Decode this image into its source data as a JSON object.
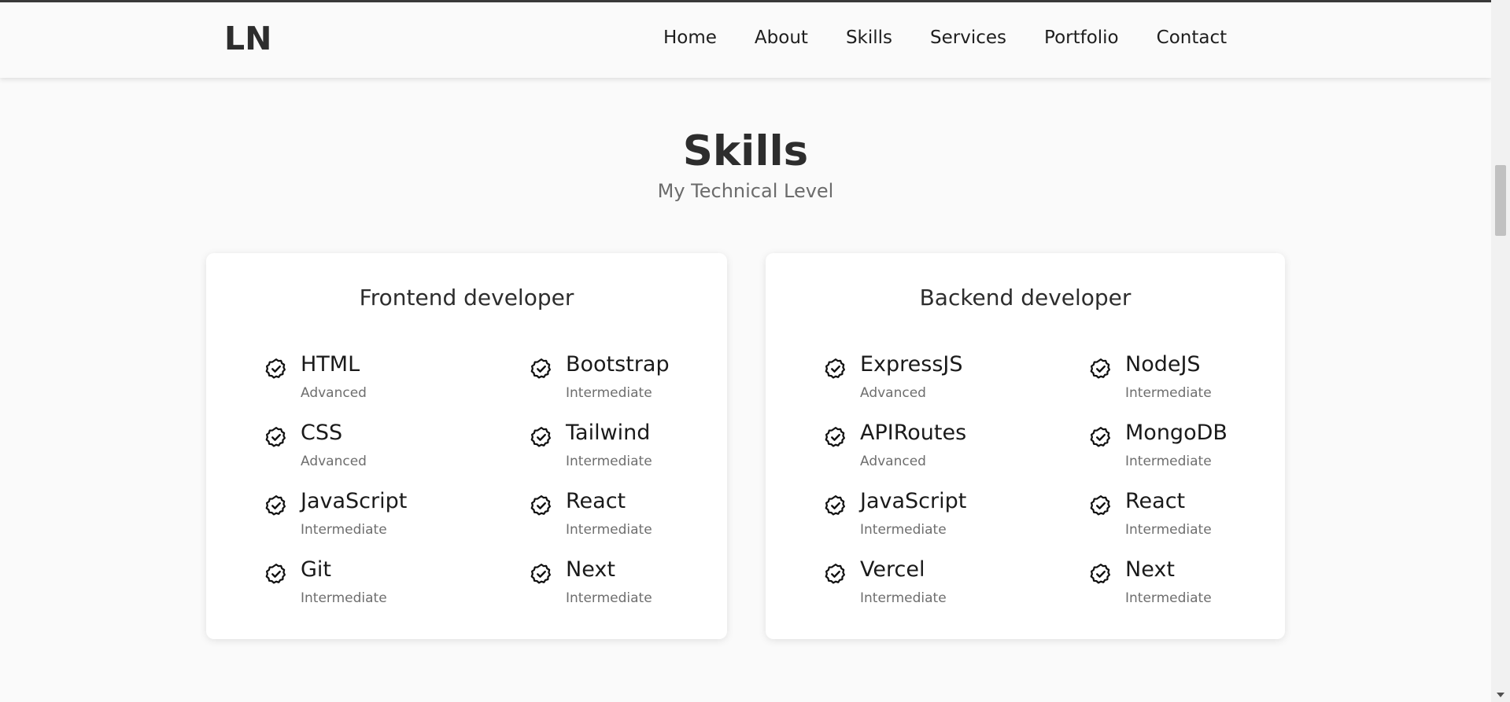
{
  "header": {
    "logo": "LN",
    "nav": [
      "Home",
      "About",
      "Skills",
      "Services",
      "Portfolio",
      "Contact"
    ]
  },
  "section": {
    "title": "Skills",
    "subtitle": "My Technical Level"
  },
  "cards": [
    {
      "title": "Frontend developer",
      "skills": [
        {
          "name": "HTML",
          "level": "Advanced"
        },
        {
          "name": "Bootstrap",
          "level": "Intermediate"
        },
        {
          "name": "CSS",
          "level": "Advanced"
        },
        {
          "name": "Tailwind",
          "level": "Intermediate"
        },
        {
          "name": "JavaScript",
          "level": "Intermediate"
        },
        {
          "name": "React",
          "level": "Intermediate"
        },
        {
          "name": "Git",
          "level": "Intermediate"
        },
        {
          "name": "Next",
          "level": "Intermediate"
        }
      ]
    },
    {
      "title": "Backend developer",
      "skills": [
        {
          "name": "ExpressJS",
          "level": "Advanced"
        },
        {
          "name": "NodeJS",
          "level": "Intermediate"
        },
        {
          "name": "APIRoutes",
          "level": "Advanced"
        },
        {
          "name": "MongoDB",
          "level": "Intermediate"
        },
        {
          "name": "JavaScript",
          "level": "Intermediate"
        },
        {
          "name": "React",
          "level": "Intermediate"
        },
        {
          "name": "Vercel",
          "level": "Intermediate"
        },
        {
          "name": "Next",
          "level": "Intermediate"
        }
      ]
    }
  ],
  "icons": {
    "skill": "badge-check-icon"
  },
  "colors": {
    "background": "#fafafa",
    "card": "#ffffff",
    "text": "#2d2d2d",
    "muted": "#6e6e6e"
  }
}
